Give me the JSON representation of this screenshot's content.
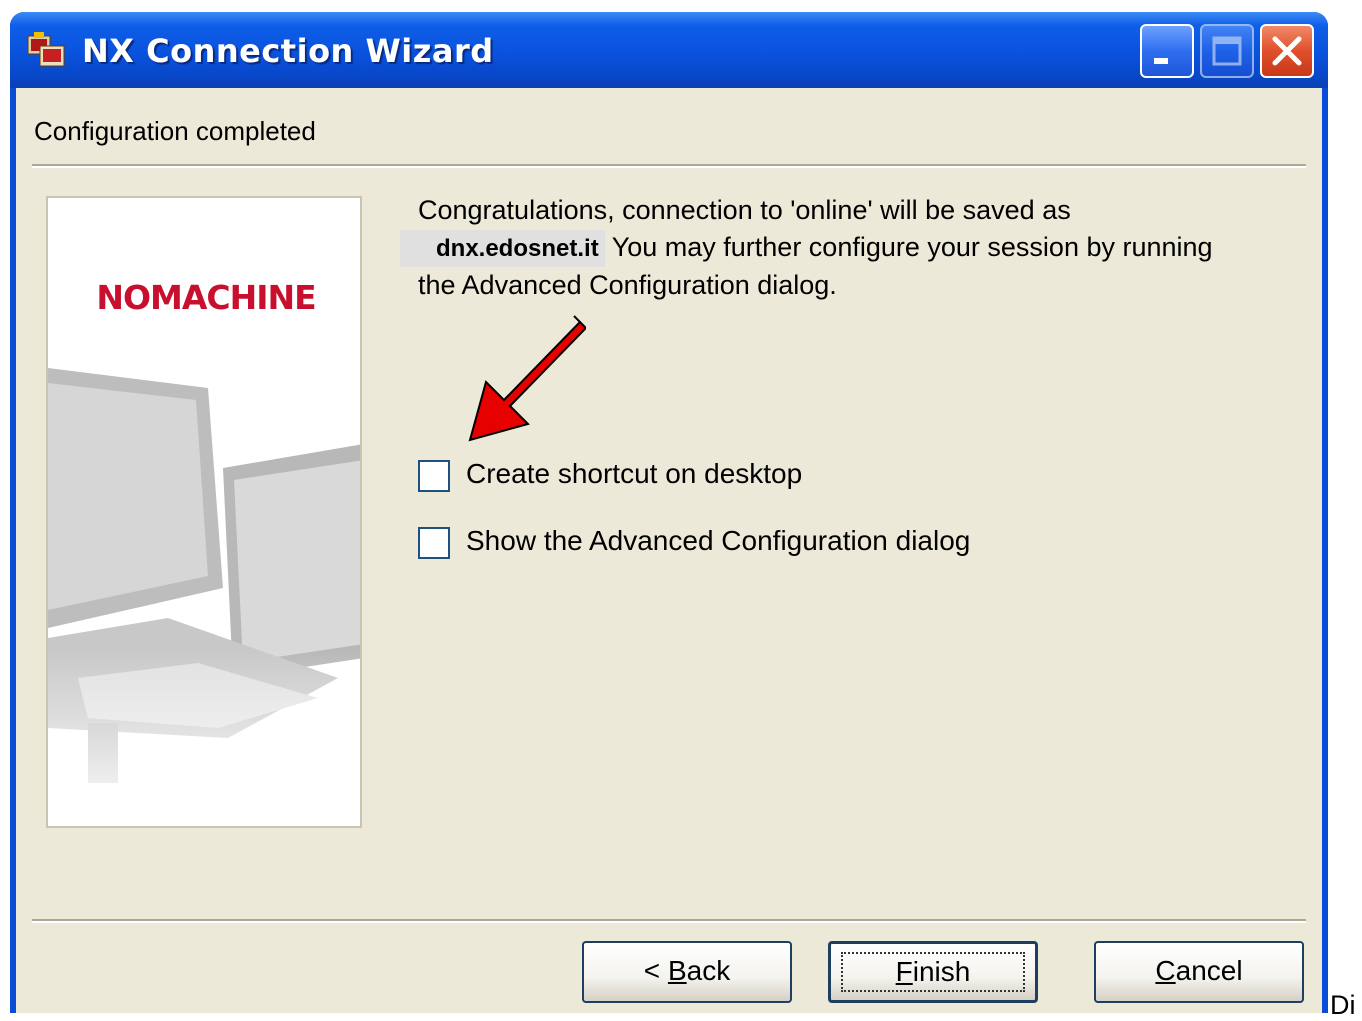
{
  "window": {
    "title": "NX Connection Wizard",
    "title_icon": "nx-wizard-icon",
    "controls": [
      "minimize-icon",
      "maximize-icon",
      "close-icon"
    ]
  },
  "header": {
    "title": "Configuration completed"
  },
  "side_panel": {
    "logo_text": "NOMACHINE",
    "illustration": "monitors-illustration"
  },
  "message": {
    "line1": "Congratulations, connection to 'online' will be saved as",
    "host": "dnx.edosnet.it",
    "line2_rest": " You may further configure your session by running",
    "line3": "the Advanced Configuration dialog."
  },
  "annotation": {
    "arrow_icon": "red-arrow-icon",
    "color": "#e60000"
  },
  "options": [
    {
      "label": "Create shortcut on desktop",
      "checked": false
    },
    {
      "label": "Show the Advanced Configuration dialog",
      "checked": false
    }
  ],
  "buttons": {
    "back": {
      "prefix": "< ",
      "accel": "B",
      "rest": "ack"
    },
    "finish": {
      "accel": "F",
      "rest": "inish"
    },
    "cancel": {
      "accel": "C",
      "rest": "ancel"
    }
  },
  "stray_text": "Di",
  "colors": {
    "titlebar": "#0a52dd",
    "dialog_bg": "#ece9d8",
    "logo": "#c8102e"
  }
}
